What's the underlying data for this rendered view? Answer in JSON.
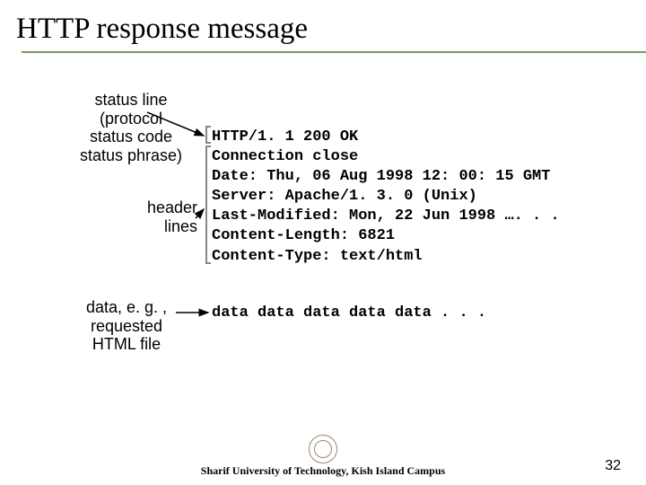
{
  "title": "HTTP response message",
  "labels": {
    "status_line": "status line\n(protocol\nstatus code\nstatus phrase)",
    "header_lines": "header\nlines",
    "data": "data, e. g. ,\nrequested\nHTML file"
  },
  "response": {
    "status_line": "HTTP/1. 1 200 OK",
    "headers": [
      "Connection close",
      "Date: Thu, 06 Aug 1998 12: 00: 15 GMT",
      "Server: Apache/1. 3. 0 (Unix)",
      "Last-Modified: Mon, 22 Jun 1998 …. . .",
      "Content-Length: 6821",
      "Content-Type: text/html"
    ],
    "data_line": "data data data data data . . ."
  },
  "footer": "Sharif University of Technology, Kish Island Campus",
  "page_number": "32"
}
